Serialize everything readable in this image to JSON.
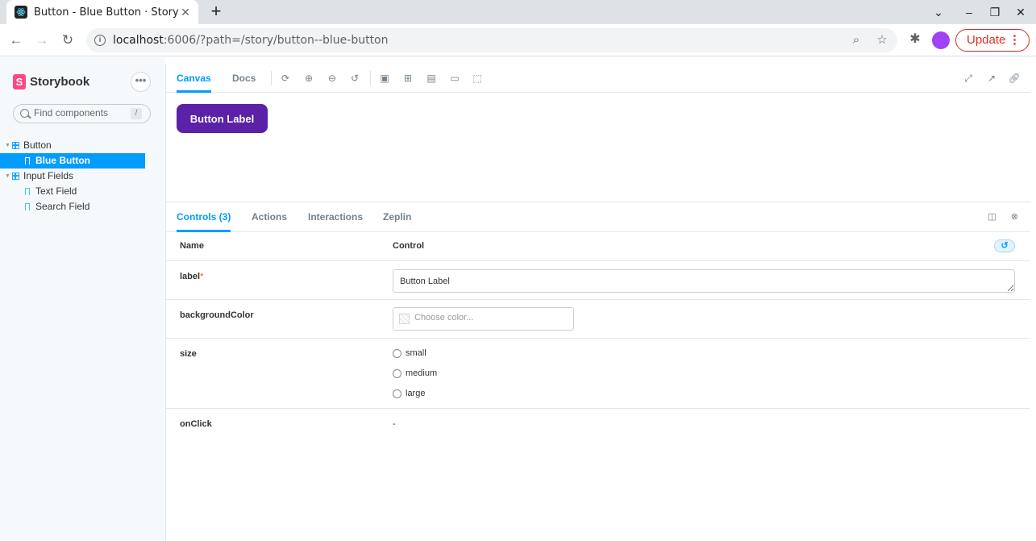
{
  "browser": {
    "tab_title": "Button - Blue Button · Storybook",
    "url_host": "localhost",
    "url_rest": ":6006/?path=/story/button--blue-button",
    "update_label": "Update"
  },
  "sidebar": {
    "brand": "Storybook",
    "search_placeholder": "Find components",
    "search_shortcut": "/",
    "tree": [
      {
        "label": "Button"
      },
      {
        "label": "Blue Button"
      },
      {
        "label": "Input Fields"
      },
      {
        "label": "Text Field"
      },
      {
        "label": "Search Field"
      }
    ]
  },
  "toolbar": {
    "tabs": [
      {
        "label": "Canvas"
      },
      {
        "label": "Docs"
      }
    ]
  },
  "preview": {
    "button_label": "Button Label",
    "button_color": "#5b21a7"
  },
  "addons": {
    "tabs": [
      {
        "label": "Controls (3)"
      },
      {
        "label": "Actions"
      },
      {
        "label": "Interactions"
      },
      {
        "label": "Zeplin"
      }
    ],
    "header": {
      "name": "Name",
      "control": "Control"
    },
    "args": {
      "label": {
        "name": "label",
        "required": "*",
        "value": "Button Label"
      },
      "backgroundColor": {
        "name": "backgroundColor",
        "placeholder": "Choose color..."
      },
      "size": {
        "name": "size",
        "options": [
          "small",
          "medium",
          "large"
        ]
      },
      "onClick": {
        "name": "onClick",
        "value": "-"
      }
    }
  },
  "colors": {
    "accent": "#029cfd",
    "brand": "#ff4785"
  }
}
